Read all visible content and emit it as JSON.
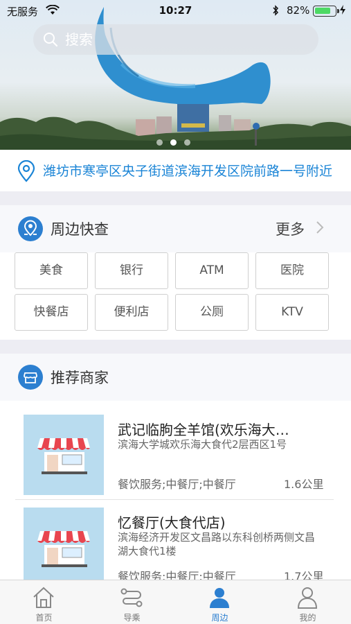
{
  "status_bar": {
    "carrier": "无服务",
    "time": "10:27",
    "battery_percent": "82%",
    "battery_level": 0.82
  },
  "search": {
    "placeholder": "搜索"
  },
  "banner": {
    "slide_count": 3,
    "active_index": 1
  },
  "location": {
    "address": "潍坊市寒亭区央子街道滨海开发区院前路一号附近"
  },
  "nearby": {
    "title": "周边快查",
    "more_label": "更多",
    "chips": [
      "美食",
      "银行",
      "ATM",
      "医院",
      "快餐店",
      "便利店",
      "公厕",
      "KTV"
    ]
  },
  "recommend": {
    "title": "推荐商家",
    "shops": [
      {
        "name": "武记临朐全羊馆(欢乐海大…",
        "address": "滨海大学城欢乐海大食代2层西区1号",
        "category": "餐饮服务;中餐厅;中餐厅",
        "distance": "1.6公里"
      },
      {
        "name": "忆餐厅(大食代店)",
        "address": "滨海经济开发区文昌路以东科创桥两侧文昌湖大食代1楼",
        "category": "餐饮服务;中餐厅;中餐厅",
        "distance": "1.7公里"
      }
    ]
  },
  "tabbar": {
    "tabs": [
      {
        "label": "首页",
        "icon": "home-icon"
      },
      {
        "label": "导乘",
        "icon": "route-icon"
      },
      {
        "label": "周边",
        "icon": "person-pin-icon"
      },
      {
        "label": "我的",
        "icon": "profile-icon"
      }
    ],
    "active_index": 2
  },
  "colors": {
    "accent": "#2c7fd0",
    "location_text": "#1a84d6",
    "page_bg": "#ededf3"
  }
}
